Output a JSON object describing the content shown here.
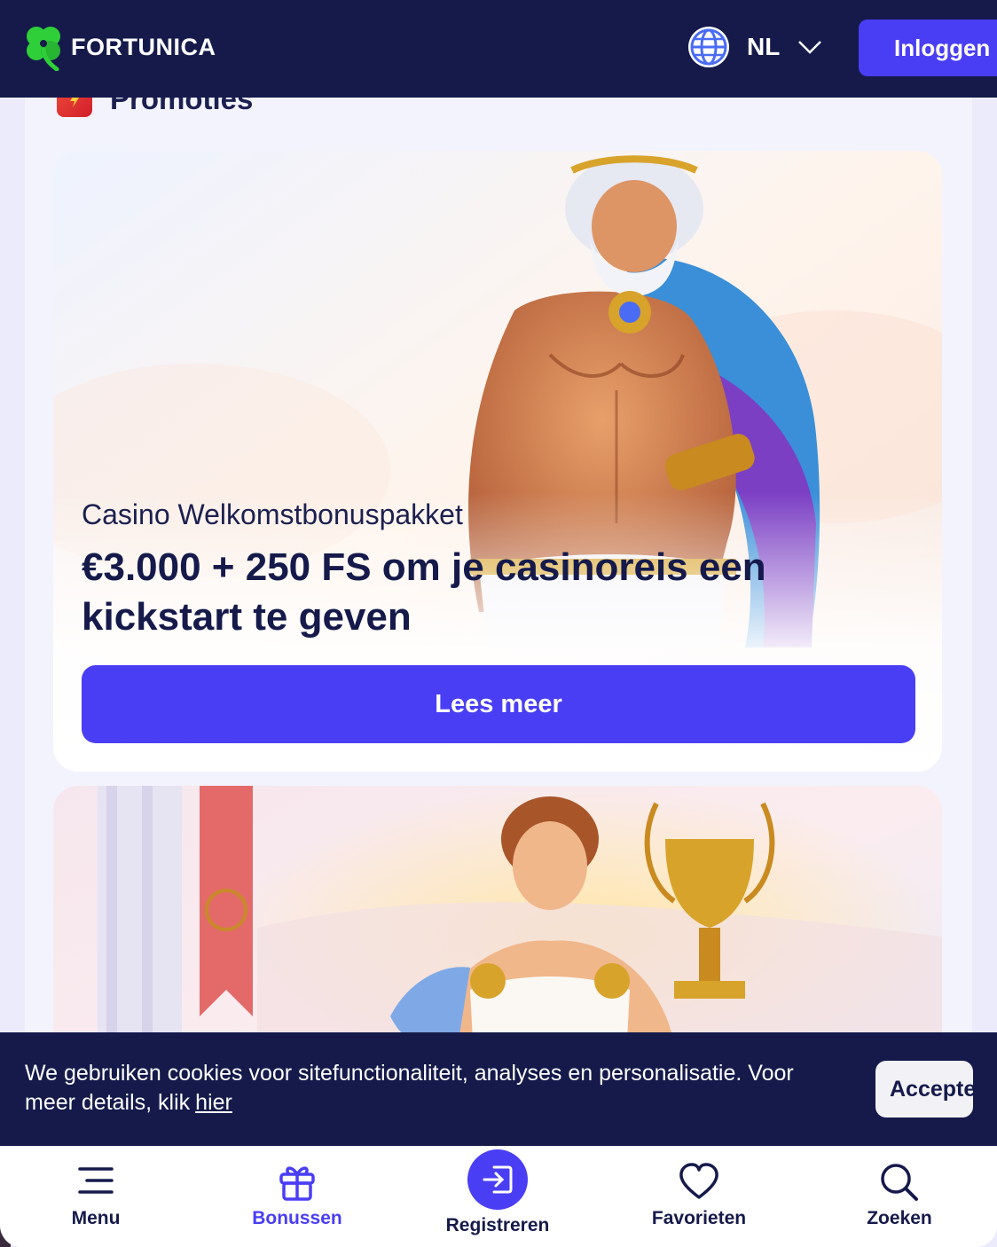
{
  "header": {
    "brand": "FORTUNICA",
    "language": "NL",
    "login_label": "Inloggen"
  },
  "section": {
    "title": "Promoties"
  },
  "promos": [
    {
      "subtitle": "Casino Welkomstbonuspakket",
      "title": "€3.000 + 250 FS om je casinoreis een kickstart te geven",
      "button_label": "Lees meer"
    }
  ],
  "cookie": {
    "text": "We gebruiken cookies voor sitefunctionaliteit, analyses en personalisatie. Voor meer details, klik",
    "link_label": "hier",
    "accept_label": "Accepteren"
  },
  "bottom_nav": {
    "menu": "Menu",
    "bonuses": "Bonussen",
    "register": "Registreren",
    "favorites": "Favorieten",
    "search": "Zoeken"
  },
  "colors": {
    "header_bg": "#151a4b",
    "accent": "#4a3ef5",
    "logo_green": "#2fcf3a",
    "page_bg": "#ecebfb"
  },
  "icons": {
    "logo": "clover-logo-icon",
    "language": "globe-icon",
    "dropdown": "chevron-down-icon",
    "section": "promo-tag-icon",
    "menu": "hamburger-icon",
    "bonuses": "gift-icon",
    "register": "sign-in-icon",
    "favorites": "heart-icon",
    "search": "magnifier-icon"
  }
}
